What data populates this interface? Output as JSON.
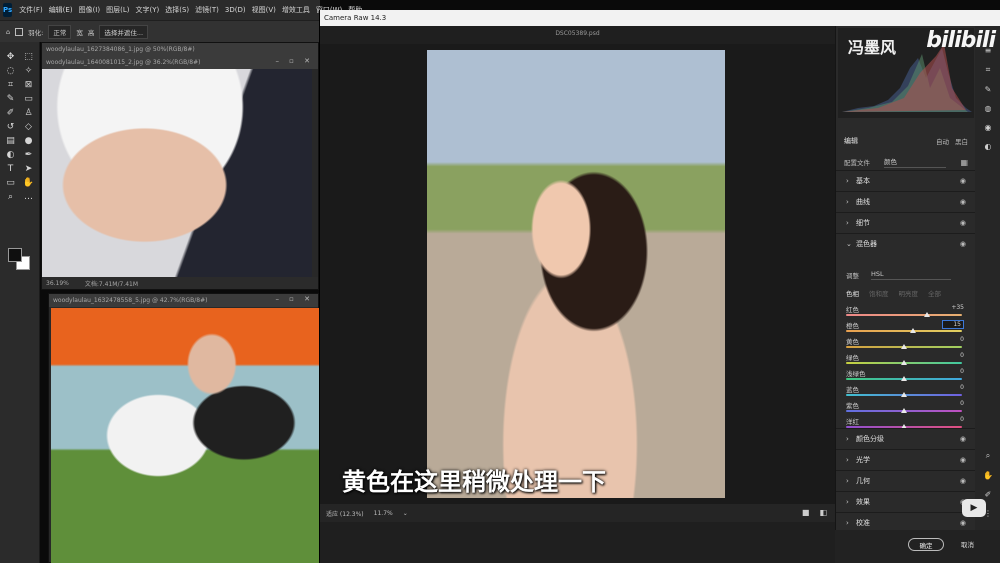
{
  "photoshop": {
    "logo": "Ps",
    "menu": [
      "文件(F)",
      "编辑(E)",
      "图像(I)",
      "图层(L)",
      "文字(Y)",
      "选择(S)",
      "滤镜(T)",
      "3D(D)",
      "视图(V)",
      "增效工具",
      "窗口(W)",
      "帮助"
    ],
    "options": {
      "feather_label": "羽化:",
      "mode_value": "正常",
      "width_label": "宽",
      "height_label": "高",
      "refine_label": "选择并遮住..."
    },
    "documents": [
      {
        "tab": "woodylaulau_1627384086_1.jpg @ 50%(RGB/8#)",
        "title": "woodylaulau_1640081015_2.jpg @ 36.2%(RGB/8#)",
        "zoom": "36.19%",
        "doc_info": "文档:7.41M/7.41M"
      },
      {
        "title": "woodylaulau_1632478558_5.jpg @ 42.7%(RGB/8#)"
      }
    ],
    "toolbar_icons": [
      "move-icon",
      "marquee-icon",
      "lasso-icon",
      "magic-wand-icon",
      "crop-icon",
      "frame-icon",
      "eyedropper-icon",
      "spot-heal-icon",
      "brush-icon",
      "stamp-icon",
      "history-brush-icon",
      "eraser-icon",
      "gradient-icon",
      "blur-icon",
      "dodge-icon",
      "pen-icon",
      "type-icon",
      "path-select-icon",
      "shape-icon",
      "hand-icon",
      "zoom-icon",
      "more-icon"
    ]
  },
  "camera_raw": {
    "title": "Camera Raw 14.3",
    "filename": "DSC05389.psd",
    "brand_name": "冯墨风",
    "brand_logo": "bilibili",
    "zoom_label": "适应 (12.3%)",
    "zoom_value": "11.7%",
    "edit_label": "编辑",
    "auto_label": "自动",
    "bw_label": "黑白",
    "profile_label": "配置文件",
    "profile_value": "颜色",
    "sections_top": [
      "基本",
      "曲线",
      "细节"
    ],
    "mixer": {
      "label": "混色器",
      "type_label": "调整",
      "type_value": "HSL",
      "tabs": [
        "色相",
        "饱和度",
        "明亮度",
        "全部"
      ],
      "active_tab": "色相",
      "sliders": [
        {
          "name": "红色",
          "value": "+35",
          "fraction": 0.7,
          "color_from": "#e88",
          "color_to": "#e8b070"
        },
        {
          "name": "橙色",
          "value": "15",
          "fraction": 0.575,
          "color_from": "#e8a050",
          "color_to": "#e0d060",
          "editing": true
        },
        {
          "name": "黄色",
          "value": "0",
          "fraction": 0.5,
          "color_from": "#d8a040",
          "color_to": "#a0d060"
        },
        {
          "name": "绿色",
          "value": "0",
          "fraction": 0.5,
          "color_from": "#c8d040",
          "color_to": "#40c8a0"
        },
        {
          "name": "浅绿色",
          "value": "0",
          "fraction": 0.5,
          "color_from": "#40c880",
          "color_to": "#40a8e0"
        },
        {
          "name": "蓝色",
          "value": "0",
          "fraction": 0.5,
          "color_from": "#40c0d0",
          "color_to": "#7060e0"
        },
        {
          "name": "紫色",
          "value": "0",
          "fraction": 0.5,
          "color_from": "#6070e0",
          "color_to": "#c050c0"
        },
        {
          "name": "洋红",
          "value": "0",
          "fraction": 0.5,
          "color_from": "#9050d0",
          "color_to": "#e05080"
        }
      ]
    },
    "sections_bottom": [
      "颜色分级",
      "光学",
      "几何",
      "效果",
      "校准"
    ],
    "ok_label": "确定",
    "cancel_label": "取消"
  },
  "subtitle": "黄色在这里稍微处理一下"
}
